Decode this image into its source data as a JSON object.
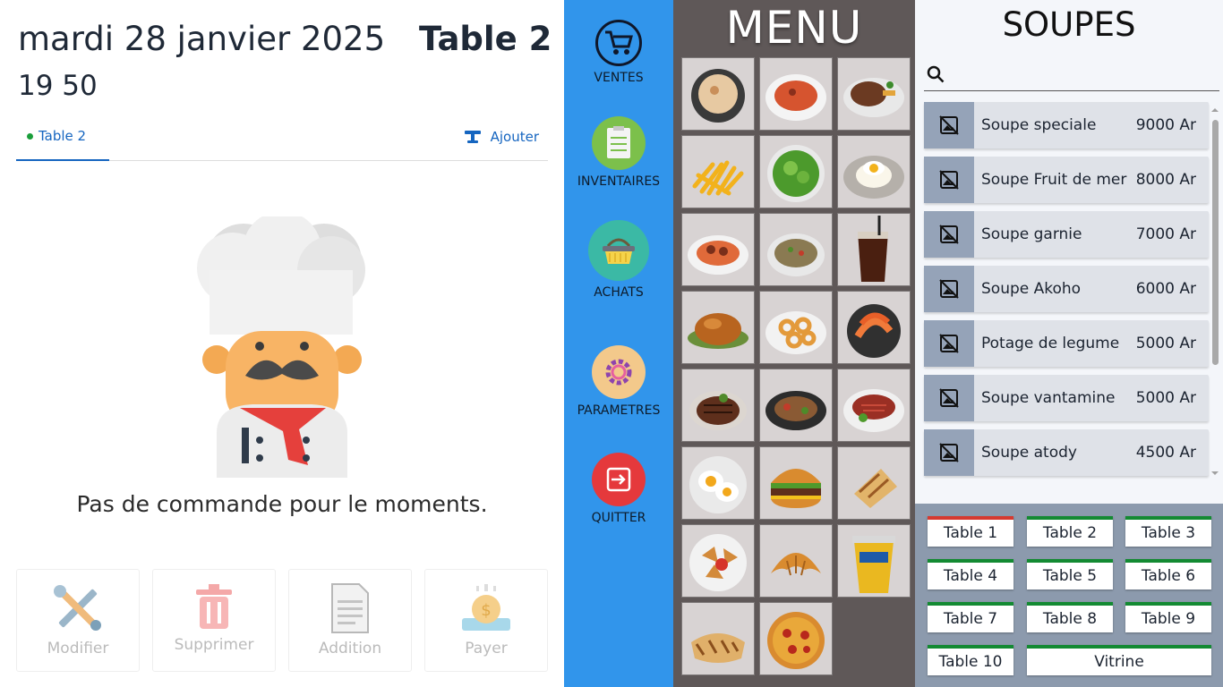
{
  "header": {
    "date": "mardi 28 janvier 2025",
    "table_title": "Table 2",
    "time": "19 50"
  },
  "tabs": [
    {
      "label": "Table 2"
    }
  ],
  "add_label": "Ajouter",
  "empty_message": "Pas de commande pour le moments.",
  "actions": [
    {
      "label": "Modifier",
      "icon": "tools-icon"
    },
    {
      "label": "Supprimer",
      "icon": "trash-icon"
    },
    {
      "label": "Addition",
      "icon": "receipt-icon"
    },
    {
      "label": "Payer",
      "icon": "payment-icon"
    }
  ],
  "nav": [
    {
      "label": "VENTES",
      "icon": "cart-icon",
      "color": "#3195eb"
    },
    {
      "label": "INVENTAIRES",
      "icon": "inventory-icon",
      "color": "#7cc04b"
    },
    {
      "label": "ACHATS",
      "icon": "basket-icon",
      "color": "#3bb9a5"
    },
    {
      "label": "PARAMETRES",
      "icon": "settings-icon",
      "color": "#f3c98b"
    },
    {
      "label": "QUITTER",
      "icon": "exit-icon",
      "color": "#e5393c"
    }
  ],
  "menu": {
    "title": "MENU",
    "categories": [
      "soup-bowl",
      "spaghetti",
      "steak",
      "fries",
      "salad",
      "rice-egg",
      "spaghetti-meatballs",
      "fried-rice",
      "cola",
      "roast-chicken",
      "calamari",
      "shrimp",
      "grilled-meat",
      "grilled-plate",
      "sliced-beef",
      "fried-eggs",
      "burger",
      "wrap",
      "samosas",
      "croissant",
      "yogurt",
      "panini",
      "pizza"
    ]
  },
  "soup_section": {
    "title": "SOUPES",
    "search_placeholder": "",
    "items": [
      {
        "name": "Soupe speciale",
        "price": "9000 Ar"
      },
      {
        "name": "Soupe Fruit de mer",
        "price": "8000 Ar"
      },
      {
        "name": "Soupe garnie",
        "price": "7000 Ar"
      },
      {
        "name": "Soupe Akoho",
        "price": "6000 Ar"
      },
      {
        "name": "Potage de legume",
        "price": "5000 Ar"
      },
      {
        "name": "Soupe vantamine",
        "price": "5000 Ar"
      },
      {
        "name": "Soupe atody",
        "price": "4500 Ar"
      }
    ]
  },
  "tables": [
    {
      "label": "Table 1",
      "status_color": "#d63a30"
    },
    {
      "label": "Table 2",
      "status_color": "#138a32"
    },
    {
      "label": "Table 3",
      "status_color": "#138a32"
    },
    {
      "label": "Table 4",
      "status_color": "#138a32"
    },
    {
      "label": "Table 5",
      "status_color": "#138a32"
    },
    {
      "label": "Table 6",
      "status_color": "#138a32"
    },
    {
      "label": "Table 7",
      "status_color": "#138a32"
    },
    {
      "label": "Table 8",
      "status_color": "#138a32"
    },
    {
      "label": "Table 9",
      "status_color": "#138a32"
    },
    {
      "label": "Table 10",
      "status_color": "#138a32"
    },
    {
      "label": "Vitrine",
      "status_color": "#138a32"
    }
  ]
}
